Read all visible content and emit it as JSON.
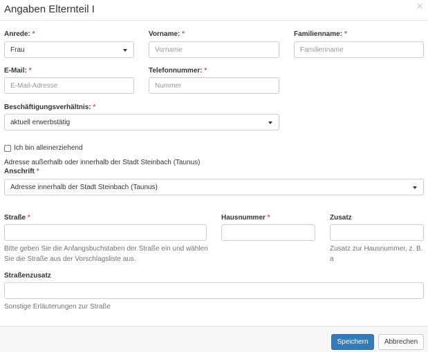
{
  "dialog": {
    "title": "Angaben Elternteil I",
    "close": "×"
  },
  "required_mark": "*",
  "anrede": {
    "label": "Anrede:",
    "value": "Frau"
  },
  "vorname": {
    "label": "Vorname:",
    "placeholder": "Vorname"
  },
  "familienname": {
    "label": "Familienname:",
    "placeholder": "Familienname"
  },
  "email": {
    "label": "E-Mail:",
    "placeholder": "E-Mail-Adresse"
  },
  "telefon": {
    "label": "Telefonnummer:",
    "placeholder": "Nummer"
  },
  "beschaeftigung": {
    "label": "Beschäftigungsverhältnis:",
    "value": "aktuell erwerbstätig"
  },
  "alleinerziehend": {
    "label": "Ich bin alleinerziehend",
    "checked": false
  },
  "adresse_info": "Adresse außerhalb oder innerhalb der Stadt Steinbach (Taunus)",
  "anschrift": {
    "label": "Anschrift",
    "value": "Adresse innerhalb der Stadt Steinbach (Taunus)"
  },
  "strasse": {
    "label": "Straße",
    "help_line1": "Bitte geben Sie die Anfangsbuchstaben der Straße ein und wählen",
    "help_line2": "Sie die Straße aus der Vorschlagsliste aus."
  },
  "hausnummer": {
    "label": "Hausnummer"
  },
  "zusatz": {
    "label": "Zusatz",
    "help_line1": "Zusatz zur Hausnummer, z. B.",
    "help_line2": "a"
  },
  "strassenzusatz": {
    "label": "Straßenzusatz",
    "help": "Sonstige Erläuterungen zur Straße"
  },
  "footer": {
    "save": "Speichern",
    "cancel": "Abbrechen"
  }
}
